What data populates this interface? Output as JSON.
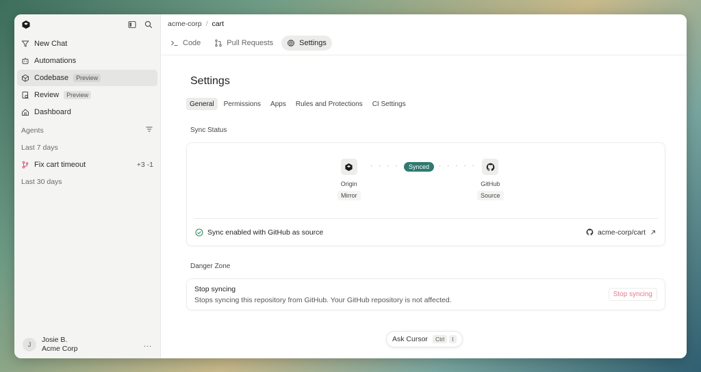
{
  "sidebar": {
    "items": [
      {
        "label": "New Chat",
        "icon": "new-chat-icon"
      },
      {
        "label": "Automations",
        "icon": "automations-icon"
      },
      {
        "label": "Codebase",
        "badge": "Preview",
        "icon": "codebase-icon",
        "active": true
      },
      {
        "label": "Review",
        "badge": "Preview",
        "icon": "review-icon"
      },
      {
        "label": "Dashboard",
        "icon": "home-icon"
      }
    ],
    "agents_label": "Agents",
    "last7_label": "Last 7 days",
    "task": {
      "label": "Fix cart timeout",
      "diff": "+3 -1"
    },
    "last30_label": "Last 30 days",
    "user": {
      "initial": "J",
      "name": "Josie B.",
      "org": "Acme Corp",
      "more": "..."
    }
  },
  "breadcrumb": {
    "org": "acme-corp",
    "sep": "/",
    "repo": "cart"
  },
  "tabs": [
    {
      "label": "Code",
      "icon": "terminal-icon"
    },
    {
      "label": "Pull Requests",
      "icon": "pull-request-icon"
    },
    {
      "label": "Settings",
      "icon": "gear-icon",
      "active": true
    }
  ],
  "settings": {
    "title": "Settings",
    "subtabs": [
      "General",
      "Permissions",
      "Apps",
      "Rules and Protections",
      "CI Settings"
    ],
    "sync_status_label": "Sync Status",
    "origin": {
      "name": "Origin",
      "tag": "Mirror"
    },
    "github": {
      "name": "GitHub",
      "tag": "Source"
    },
    "synced_label": "Synced",
    "dots_left": "· · · · ·",
    "dots_right": "· · · · ·",
    "sync_message": "Sync enabled with GitHub as source",
    "repo_link": "acme-corp/cart",
    "danger_zone_label": "Danger Zone",
    "danger": {
      "title": "Stop syncing",
      "description": "Stops syncing this repository from GitHub. Your GitHub repository is not affected.",
      "button": "Stop syncing"
    }
  },
  "ask": {
    "label": "Ask Cursor",
    "kbd1": "Ctrl",
    "kbd2": "I"
  },
  "colors": {
    "accent": "#2f7a70",
    "danger": "#e07a8a"
  }
}
